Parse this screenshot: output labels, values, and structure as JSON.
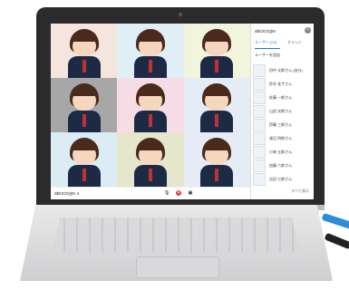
{
  "screen": {
    "panel": {
      "title": "abcxcxyjw",
      "close_icon": "close-icon",
      "tabs": [
        {
          "label": "ユーザー (24)"
        },
        {
          "label": "チャット"
        }
      ],
      "add_user_label": "ユーザーを追加",
      "participants": [
        {
          "name": "田中 太郎さん (自分)"
        },
        {
          "name": "鈴木 花子さん"
        },
        {
          "name": "佐藤 一郎さん"
        },
        {
          "name": "山田 次郎さん"
        },
        {
          "name": "伊藤 三郎さん"
        },
        {
          "name": "渡辺 四郎さん"
        },
        {
          "name": "小林 五郎さん"
        },
        {
          "name": "加藤 六郎さん"
        },
        {
          "name": "吉田 七郎さん"
        }
      ]
    },
    "bottom_bar": {
      "meeting_code": "abcxcxyjw ∧"
    },
    "tiles": [
      {
        "bg": "#f6e5dc"
      },
      {
        "bg": "#e0eef5"
      },
      {
        "bg": "#f0f5dc"
      },
      {
        "bg": "#a7a7a7"
      },
      {
        "bg": "#f6dde5"
      },
      {
        "bg": "#e6ecf6"
      },
      {
        "bg": "#dcecf5"
      },
      {
        "bg": "#e6e6cc"
      },
      {
        "bg": "#e6ecf6"
      }
    ],
    "side_button_label": "すべて表示"
  }
}
